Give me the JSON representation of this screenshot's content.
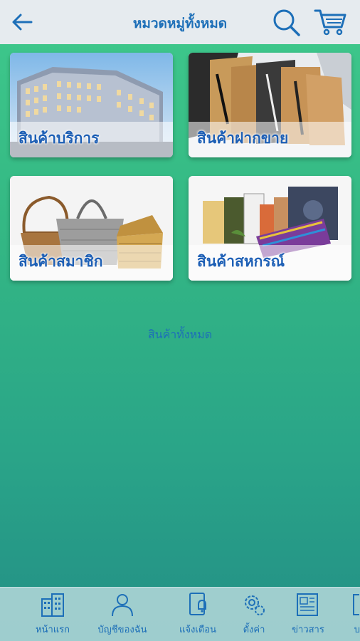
{
  "header": {
    "title": "หมวดหมู่ทั้งหมด",
    "back_icon": "arrow-left-icon",
    "search_icon": "search-icon",
    "cart_icon": "cart-icon"
  },
  "categories": [
    {
      "label": "สินค้าบริการ",
      "image": "hotel-building"
    },
    {
      "label": "สินค้าฝากขาย",
      "image": "wrapped-knives"
    },
    {
      "label": "สินค้าสมาชิก",
      "image": "woven-baskets"
    },
    {
      "label": "สินค้าสหกรณ์",
      "image": "local-goods-bundle"
    }
  ],
  "all_products_label": "สินค้าทั้งหมด",
  "bottom_nav": [
    {
      "label": "หน้าแรก",
      "icon": "building-icon"
    },
    {
      "label": "บัญชีของฉัน",
      "icon": "user-icon"
    },
    {
      "label": "แจ้งเตือน",
      "icon": "notification-icon"
    },
    {
      "label": "ตั้งค่า",
      "icon": "settings-icon"
    },
    {
      "label": "ข่าวสาร",
      "icon": "news-icon"
    },
    {
      "label": "บ",
      "icon": "more-icon"
    }
  ],
  "colors": {
    "accent": "#1d6fb8",
    "header_bg": "#e6ebef",
    "bg_top": "#3fc98c",
    "bg_bottom": "#238f86"
  }
}
